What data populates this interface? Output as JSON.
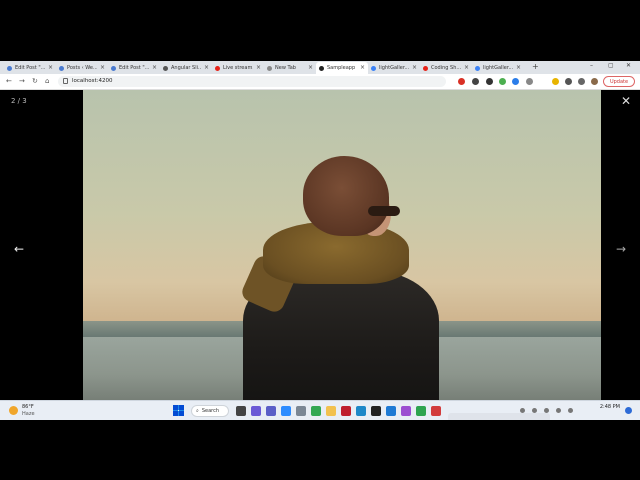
{
  "browser": {
    "tabs": [
      {
        "label": "Edit Post \"...",
        "favicon_color": "#4a7bd0",
        "active": false
      },
      {
        "label": "Posts ‹ We...",
        "favicon_color": "#4a7bd0",
        "active": false
      },
      {
        "label": "Edit Post \"...",
        "favicon_color": "#4a7bd0",
        "active": false
      },
      {
        "label": "Angular Sli...",
        "favicon_color": "#555555",
        "active": false
      },
      {
        "label": "Live stream...",
        "favicon_color": "#e62117",
        "active": false
      },
      {
        "label": "New Tab",
        "favicon_color": "#888888",
        "active": false
      },
      {
        "label": "Sampleapp",
        "favicon_color": "#222222",
        "active": true
      },
      {
        "label": "lightGaller...",
        "favicon_color": "#3b82f6",
        "active": false
      },
      {
        "label": "Coding Sh...",
        "favicon_color": "#e62117",
        "active": false
      },
      {
        "label": "lightGaller...",
        "favicon_color": "#3b82f6",
        "active": false
      }
    ],
    "tab_close": "×",
    "new_tab": "+",
    "window_controls": {
      "minimize": "–",
      "maximize": "▢",
      "close": "✕"
    },
    "nav": {
      "back": "←",
      "forward": "→",
      "reload": "↻",
      "home": "⌂"
    },
    "url": "localhost:4200",
    "update_label": "Update"
  },
  "lightbox": {
    "counter": "2 / 3",
    "close": "✕",
    "prev": "←",
    "next": "→"
  },
  "taskbar": {
    "weather_temp": "86°F",
    "weather_condition": "Haze",
    "search_label": "Search",
    "search_icon": "⌕",
    "time": "2:48 PM",
    "date": "",
    "apps": [
      {
        "name": "taskview",
        "color": "#444444"
      },
      {
        "name": "widgets",
        "color": "#6b5ad6"
      },
      {
        "name": "teams",
        "color": "#5b5fc7"
      },
      {
        "name": "zoom",
        "color": "#2d8cff"
      },
      {
        "name": "monitor",
        "color": "#7b8794"
      },
      {
        "name": "chrome",
        "color": "#34a853"
      },
      {
        "name": "explorer",
        "color": "#f2c14e"
      },
      {
        "name": "filezilla",
        "color": "#bf1e2d"
      },
      {
        "name": "app-blue",
        "color": "#1e88c8"
      },
      {
        "name": "terminal",
        "color": "#222222"
      },
      {
        "name": "vscode",
        "color": "#1f7ad4"
      },
      {
        "name": "app-purple",
        "color": "#9c4fd1"
      },
      {
        "name": "app-green",
        "color": "#2ea44f"
      },
      {
        "name": "app-red",
        "color": "#d23c3c"
      }
    ]
  }
}
